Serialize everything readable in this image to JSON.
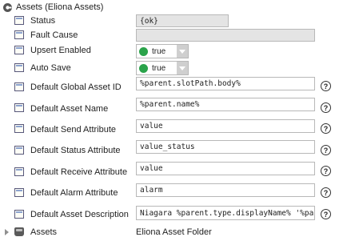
{
  "header": {
    "title": "Assets  (Eliona Assets)",
    "icon": "collapse-circle-icon"
  },
  "properties": [
    {
      "label": "Status",
      "value": "{ok}",
      "kind": "readonly",
      "help": false
    },
    {
      "label": "Fault Cause",
      "value": "",
      "kind": "readonly",
      "help": false
    },
    {
      "label": "Upsert Enabled",
      "value": "true",
      "kind": "dropdown",
      "help": false,
      "status_color": "#2aa34a"
    },
    {
      "label": "Auto Save",
      "value": "true",
      "kind": "dropdown",
      "help": false,
      "status_color": "#2aa34a"
    },
    {
      "label": "Default Global Asset ID",
      "value": "%parent.slotPath.body%",
      "kind": "text",
      "help": true
    },
    {
      "label": "Default Asset Name",
      "value": "%parent.name%",
      "kind": "text",
      "help": true
    },
    {
      "label": "Default Send Attribute",
      "value": "value",
      "kind": "text",
      "help": true
    },
    {
      "label": "Default Status Attribute",
      "value": "value_status",
      "kind": "text",
      "help": true
    },
    {
      "label": "Default Receive Attribute",
      "value": "value",
      "kind": "text",
      "help": true
    },
    {
      "label": "Default Alarm Attribute",
      "value": "alarm",
      "kind": "text",
      "help": true
    },
    {
      "label": "Default Asset Description",
      "value": "Niagara %parent.type.displayName% '%parent",
      "kind": "text",
      "help": true
    }
  ],
  "help_symbol": "?",
  "assets_folder": {
    "label": "Assets",
    "type": "Eliona Asset Folder"
  }
}
